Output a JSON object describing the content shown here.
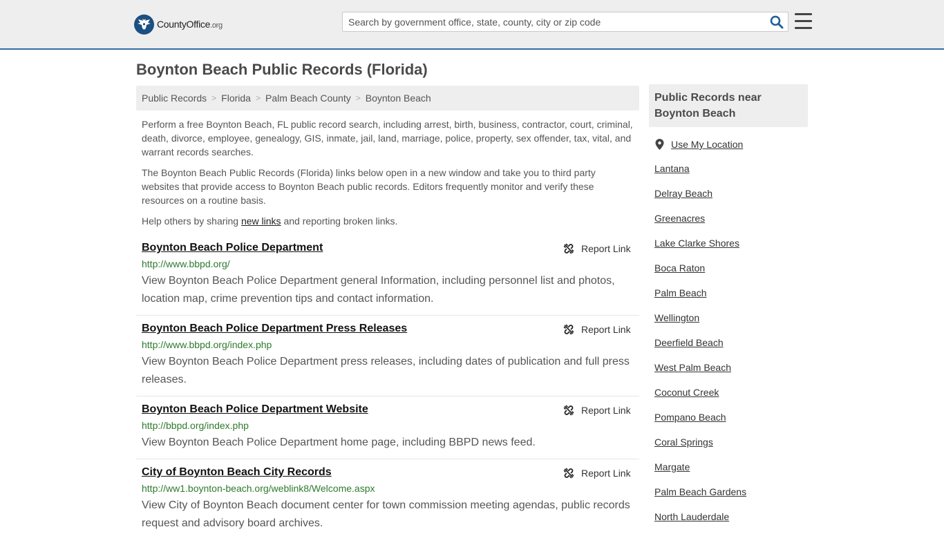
{
  "header": {
    "logo_main": "CountyOffice",
    "logo_suffix": ".org",
    "search_placeholder": "Search by government office, state, county, city or zip code"
  },
  "page_title": "Boynton Beach Public Records (Florida)",
  "breadcrumb": [
    "Public Records",
    "Florida",
    "Palm Beach County",
    "Boynton Beach"
  ],
  "intro": {
    "p1": "Perform a free Boynton Beach, FL public record search, including arrest, birth, business, contractor, court, criminal, death, divorce, employee, genealogy, GIS, inmate, jail, land, marriage, police, property, sex offender, tax, vital, and warrant records searches.",
    "p2": "The Boynton Beach Public Records (Florida) links below open in a new window and take you to third party websites that provide access to Boynton Beach public records. Editors frequently monitor and verify these resources on a routine basis.",
    "p3_before": "Help others by sharing ",
    "p3_link": "new links",
    "p3_after": " and reporting broken links."
  },
  "report_label": "Report Link",
  "records": [
    {
      "title": "Boynton Beach Police Department",
      "url": "http://www.bbpd.org/",
      "desc": "View Boynton Beach Police Department general Information, including personnel list and photos, location map, crime prevention tips and contact information."
    },
    {
      "title": "Boynton Beach Police Department Press Releases",
      "url": "http://www.bbpd.org/index.php",
      "desc": "View Boynton Beach Police Department press releases, including dates of publication and full press releases."
    },
    {
      "title": "Boynton Beach Police Department Website",
      "url": "http://bbpd.org/index.php",
      "desc": "View Boynton Beach Police Department home page, including BBPD news feed."
    },
    {
      "title": "City of Boynton Beach City Records",
      "url": "http://ww1.boynton-beach.org/weblink8/Welcome.aspx",
      "desc": "View City of Boynton Beach document center for town commission meeting agendas, public records request and advisory board archives."
    }
  ],
  "sidebar": {
    "heading": "Public Records near Boynton Beach",
    "use_location": "Use My Location",
    "places": [
      "Lantana",
      "Delray Beach",
      "Greenacres",
      "Lake Clarke Shores",
      "Boca Raton",
      "Palm Beach",
      "Wellington",
      "Deerfield Beach",
      "West Palm Beach",
      "Coconut Creek",
      "Pompano Beach",
      "Coral Springs",
      "Margate",
      "Palm Beach Gardens",
      "North Lauderdale"
    ]
  }
}
